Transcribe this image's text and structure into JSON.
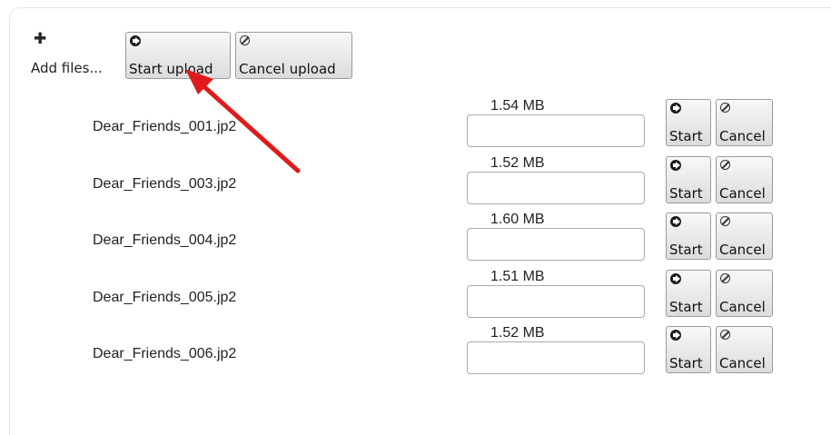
{
  "toolbar": {
    "add_files_label": "Add files...",
    "add_files_icon": "plus-icon",
    "start_upload_label": "Start upload",
    "start_upload_icon": "circle-arrow-right-icon",
    "cancel_upload_label": "Cancel upload",
    "cancel_upload_icon": "ban-icon"
  },
  "files": [
    {
      "name": "Dear_Friends_001.jp2",
      "size": "1.54 MB",
      "progress": 0,
      "start_label": "Start",
      "cancel_label": "Cancel"
    },
    {
      "name": "Dear_Friends_003.jp2",
      "size": "1.52 MB",
      "progress": 0,
      "start_label": "Start",
      "cancel_label": "Cancel"
    },
    {
      "name": "Dear_Friends_004.jp2",
      "size": "1.60 MB",
      "progress": 0,
      "start_label": "Start",
      "cancel_label": "Cancel"
    },
    {
      "name": "Dear_Friends_005.jp2",
      "size": "1.51 MB",
      "progress": 0,
      "start_label": "Start",
      "cancel_label": "Cancel"
    },
    {
      "name": "Dear_Friends_006.jp2",
      "size": "1.52 MB",
      "progress": 0,
      "start_label": "Start",
      "cancel_label": "Cancel"
    }
  ],
  "annotation": {
    "arrow_color": "#e01a1a"
  }
}
